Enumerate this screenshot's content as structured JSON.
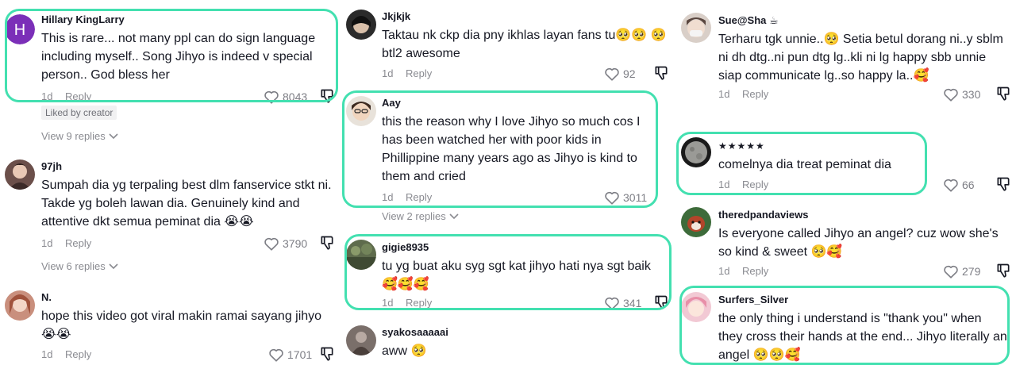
{
  "comments": {
    "hillary": {
      "username": "Hillary KingLarry",
      "avatar_letter": "H",
      "text": "This is rare... not many ppl can do sign language including myself.. Song Jihyo is indeed v special person.. God bless her",
      "time": "1d",
      "reply": "Reply",
      "likes": "8043",
      "badge": "Liked by creator",
      "view_replies": "View 9 replies"
    },
    "c97jh": {
      "username": "97jh",
      "text": "Sumpah dia yg terpaling best dlm fanservice stkt ni. Takde yg boleh lawan dia. Genuinely kind and attentive dkt semua peminat dia 😭😭",
      "time": "1d",
      "reply": "Reply",
      "likes": "3790",
      "view_replies": "View 6 replies"
    },
    "n": {
      "username": "N.",
      "text": "hope this video got viral makin ramai sayang jihyo😭😭",
      "time": "1d",
      "reply": "Reply",
      "likes": "1701"
    },
    "jkjkjk": {
      "username": "Jkjkjk",
      "text": "Taktau nk ckp dia pny ikhlas layan fans tu🥺🥺 🥺 btl2 awesome",
      "time": "1d",
      "reply": "Reply",
      "likes": "92"
    },
    "aay": {
      "username": "Aay",
      "text": "this the reason why I love Jihyo so much cos I has been watched her with poor kids in Phillippine many years ago as Jihyo is kind to them and cried",
      "time": "1d",
      "reply": "Reply",
      "likes": "3011",
      "view_replies": "View 2 replies"
    },
    "gigie": {
      "username": "gigie8935",
      "text": "tu yg buat aku syg sgt kat jihyo hati nya sgt baik 🥰🥰🥰",
      "time": "1d",
      "reply": "Reply",
      "likes": "341"
    },
    "syako": {
      "username": "syakosaaaaai",
      "text": "aww 🥺"
    },
    "sue": {
      "username": "Sue@Sha",
      "username_suffix": "☕",
      "text": "Terharu tgk unnie..🥺 Setia betul dorang ni..y sblm ni dh dtg..ni pun dtg lg..kli ni lg happy sbb unnie siap communicate lg..so happy la..🥰",
      "time": "1d",
      "reply": "Reply",
      "likes": "330"
    },
    "stars": {
      "username": "★★★★★",
      "text": "comelnya dia treat peminat dia",
      "time": "1d",
      "reply": "Reply",
      "likes": "66"
    },
    "redpanda": {
      "username": "theredpandaviews",
      "text": "Is everyone called Jihyo an angel? cuz wow she's so kind & sweet 🥺🥰",
      "time": "1d",
      "reply": "Reply",
      "likes": "279"
    },
    "surfers": {
      "username": "Surfers_Silver",
      "text": "the only thing i understand is \"thank you\" when they cross their hands at the end... Jihyo literally an angel 🥺🥺🥰"
    }
  },
  "colors": {
    "highlight": "#43e0b0",
    "muted": "#8a8b91",
    "text": "#161823",
    "avatar_purple": "#7b2fb8"
  },
  "icons": {
    "like": "heart-outline-icon",
    "dislike": "thumbs-down-icon",
    "chevron": "chevron-down-icon"
  }
}
